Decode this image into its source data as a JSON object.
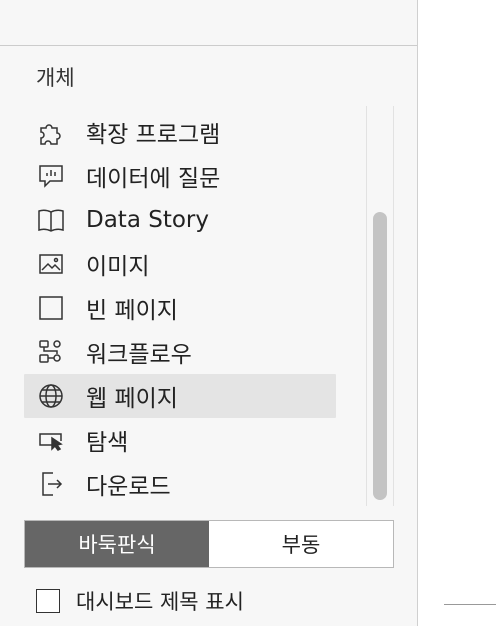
{
  "panel": {
    "section_title": "개체",
    "items": [
      {
        "label": "확장 프로그램",
        "icon": "puzzle-icon"
      },
      {
        "label": "데이터에 질문",
        "icon": "chat-bar-icon"
      },
      {
        "label": "Data Story",
        "icon": "book-icon"
      },
      {
        "label": "이미지",
        "icon": "image-icon"
      },
      {
        "label": "빈 페이지",
        "icon": "blank-square-icon"
      },
      {
        "label": "워크플로우",
        "icon": "workflow-icon"
      },
      {
        "label": "웹 페이지",
        "icon": "globe-icon",
        "selected": true
      },
      {
        "label": "탐색",
        "icon": "navigation-cursor-icon"
      },
      {
        "label": "다운로드",
        "icon": "download-export-icon"
      }
    ],
    "layout_toggle": {
      "options": [
        "바둑판식",
        "부동"
      ],
      "selected": "바둑판식"
    },
    "show_title": {
      "label": "대시보드 제목 표시",
      "checked": false
    }
  },
  "colors": {
    "panel_bg": "#f7f7f7",
    "selected_item_bg": "#e4e4e4",
    "toggle_active_bg": "#666666"
  }
}
